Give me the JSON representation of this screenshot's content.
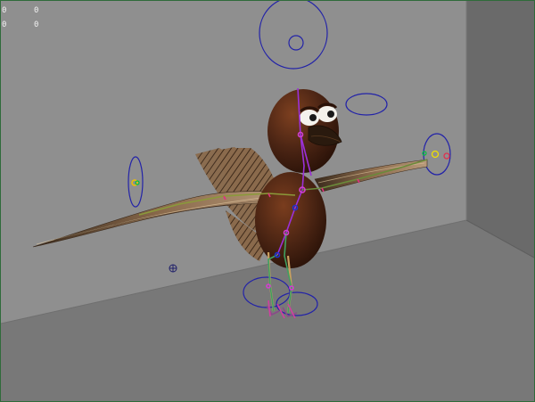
{
  "viewport": {
    "hud_stats": [
      {
        "left": "0",
        "right": "0"
      },
      {
        "left": "0",
        "right": "0"
      }
    ]
  },
  "colors": {
    "frame": "#2f6b3a",
    "back_wall": "#8f8f8f",
    "side_wall": "#6e6e6e",
    "floor": "#7a7a7a",
    "control_curve": "#2323a8",
    "bird_body": "#4a2413",
    "feather": "#9b7a5c"
  },
  "icons": {
    "manipulator": "crosshair-circle-icon"
  }
}
